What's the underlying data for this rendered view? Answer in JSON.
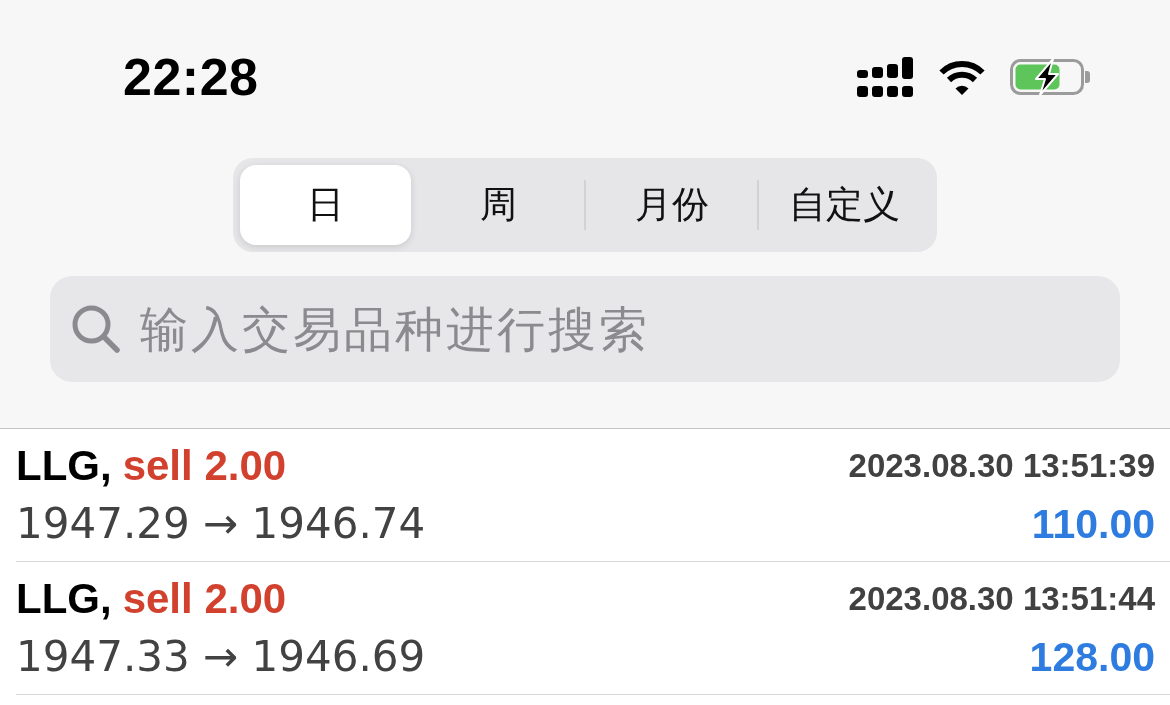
{
  "status_bar": {
    "time": "22:28"
  },
  "period_tabs": [
    {
      "label": "日",
      "selected": true
    },
    {
      "label": "周",
      "selected": false
    },
    {
      "label": "月份",
      "selected": false
    },
    {
      "label": "自定义",
      "selected": false
    }
  ],
  "search": {
    "placeholder": "输入交易品种进行搜索"
  },
  "trades": [
    {
      "symbol": "LLG,",
      "order": "sell 2.00",
      "time": "2023.08.30 13:51:39",
      "prices": "1947.29 → 1946.74",
      "profit": "110.00"
    },
    {
      "symbol": "LLG,",
      "order": "sell 2.00",
      "time": "2023.08.30 13:51:44",
      "prices": "1947.33 → 1946.69",
      "profit": "128.00"
    }
  ]
}
